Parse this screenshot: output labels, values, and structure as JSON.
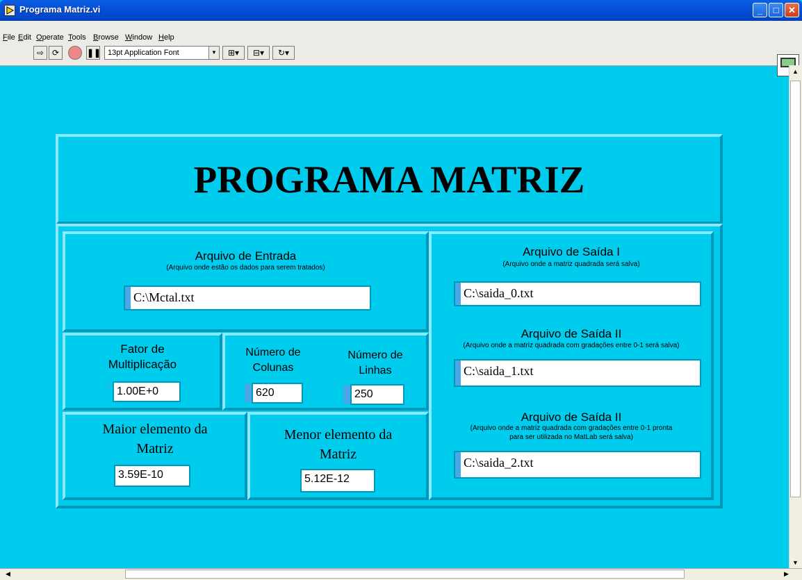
{
  "window": {
    "title": "Programa Matriz.vi"
  },
  "menu": [
    "File",
    "Edit",
    "Operate",
    "Tools",
    "Browse",
    "Window",
    "Help"
  ],
  "toolbar": {
    "font": "13pt Application Font"
  },
  "header": {
    "title": "PROGRAMA MATRIZ"
  },
  "entrada": {
    "label": "Arquivo de Entrada",
    "note": "(Arquivo onde estão os dados para serem tratados)",
    "value": "C:\\Mctal.txt"
  },
  "fator": {
    "label1": "Fator de",
    "label2": "Multiplicação",
    "value": "1.00E+0"
  },
  "colunas": {
    "label1": "Número de",
    "label2": "Colunas",
    "value": "620"
  },
  "linhas": {
    "label1": "Número de",
    "label2": "Linhas",
    "value": "250"
  },
  "maior": {
    "label1": "Maior elemento da",
    "label2": "Matriz",
    "value": "3.59E-10"
  },
  "menor": {
    "label1": "Menor elemento da",
    "label2": "Matriz",
    "value": "5.12E-12"
  },
  "saida1": {
    "label": "Arquivo de Saída I",
    "note": "(Arquivo onde a matriz quadrada será salva)",
    "value": "C:\\saida_0.txt"
  },
  "saida2": {
    "label": "Arquivo de Saída II",
    "note": "(Arquivo onde a matriz quadrada com gradações entre 0-1 será salva)",
    "value": "C:\\saida_1.txt"
  },
  "saida3": {
    "label": "Arquivo de Saída II",
    "note1": "(Arquivo onde a matriz quadrada com gradações entre 0-1 pronta",
    "note2": "para ser utilizada no MatLab será salva)",
    "value": "C:\\saida_2.txt"
  }
}
